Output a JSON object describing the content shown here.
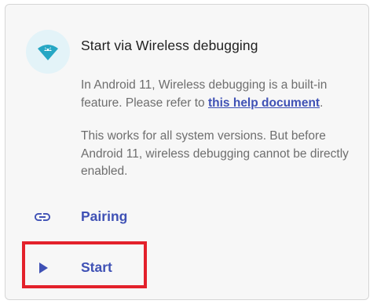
{
  "card": {
    "title": "Start via Wireless debugging",
    "description_1_text": "In Android 11, Wireless debugging is a built-in feature. Please refer to ",
    "description_1_link": "this help document",
    "description_1_end": ".",
    "description_2": "This works for all system versions. But before Android 11, wireless debugging cannot be directly enabled.",
    "header_icon": "android-wifi-icon"
  },
  "actions": [
    {
      "label": "Pairing",
      "icon": "link-icon"
    },
    {
      "label": "Start",
      "icon": "play-icon"
    }
  ],
  "colors": {
    "accent": "#3f51b5",
    "icon_teal": "#26a7c4",
    "icon_circle_bg": "#e3f3f8",
    "highlight": "#e3212b"
  }
}
